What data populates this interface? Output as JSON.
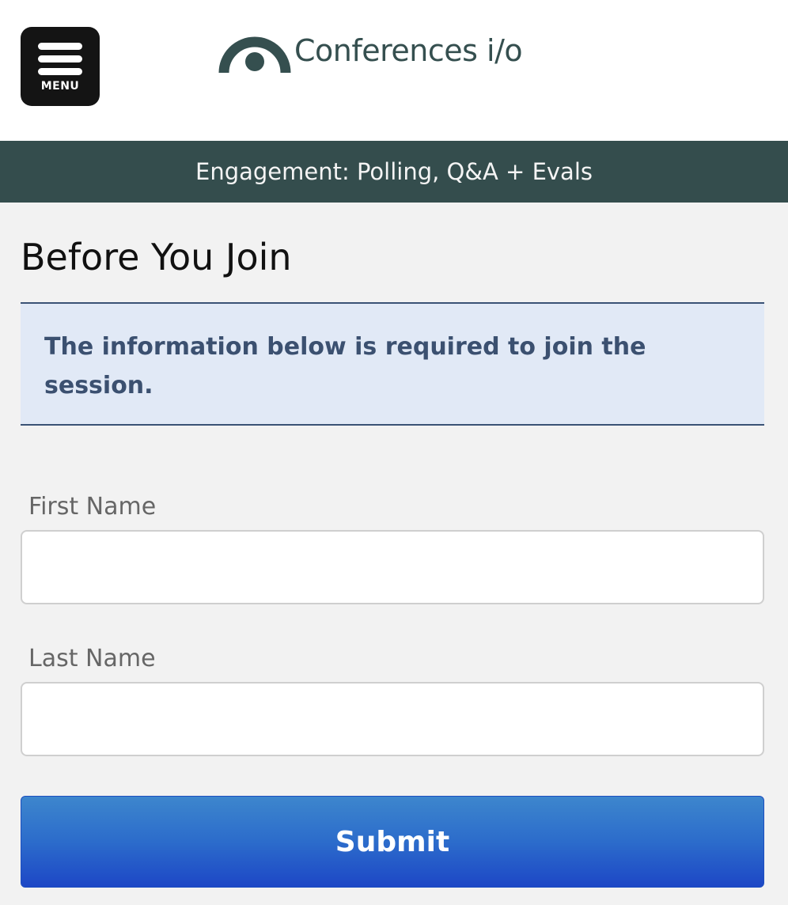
{
  "header": {
    "menu_label": "MENU",
    "logo_text": "Conferences i/o",
    "logo_color": "#354f4f"
  },
  "banner": {
    "text": "Engagement: Polling, Q&A + Evals",
    "background": "#344d4d"
  },
  "page": {
    "title": "Before You Join"
  },
  "alert": {
    "message": "The information below is required to join the session.",
    "background": "#e1e9f6",
    "text_color": "#3b5070"
  },
  "form": {
    "first_name": {
      "label": "First Name",
      "value": "",
      "placeholder": ""
    },
    "last_name": {
      "label": "Last Name",
      "value": "",
      "placeholder": ""
    },
    "submit_label": "Submit"
  },
  "icons": {
    "menu": "hamburger-icon",
    "logo": "conferences-io-logo"
  }
}
